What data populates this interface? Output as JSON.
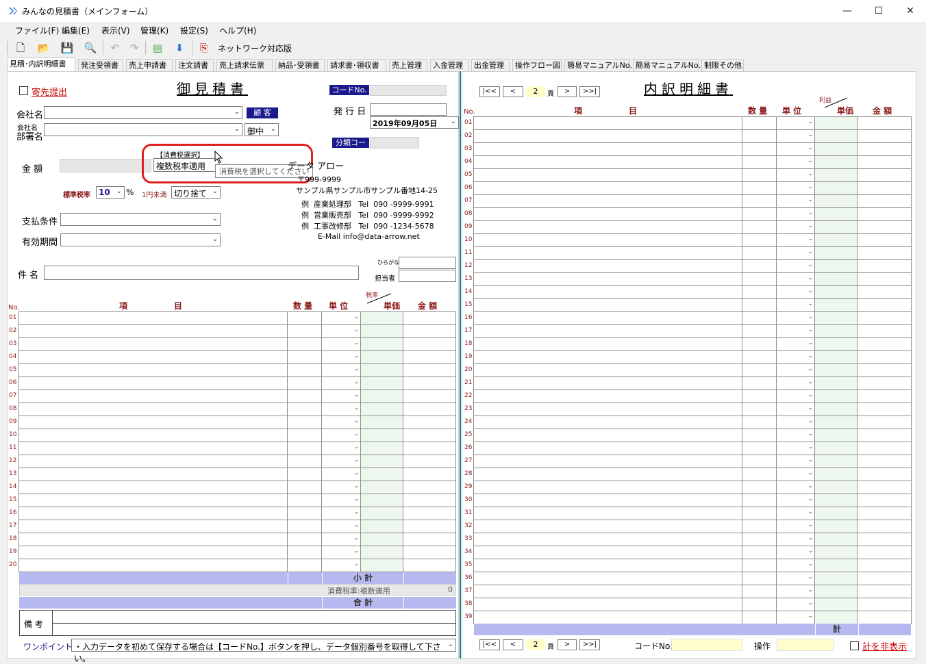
{
  "window": {
    "title": "みんなの見積書（メインフォーム）",
    "minimize": "—",
    "maximize": "☐",
    "close": "✕"
  },
  "menu": [
    "ファイル(F)",
    "編集(E)",
    "表示(V)",
    "管理(K)",
    "設定(S)",
    "ヘルプ(H)"
  ],
  "toolbar": {
    "network_label": "ネットワーク対応版"
  },
  "tabs": [
    "見積･内訳明細書",
    "発注受領書",
    "売上申請書",
    "注文請書",
    "売上請求伝票",
    "納品･受領書",
    "請求書･領収書",
    "売上管理",
    "入金管理",
    "出金管理",
    "操作フロー図",
    "簡易マニュアルNo.1",
    "簡易マニュアルNo.2",
    "制限その他"
  ],
  "estimate": {
    "title": "御見積書",
    "send_check": "寄先提出",
    "code_btn": "コードNo.",
    "issue_date_label": "発 行 日",
    "issue_date": "2019年09月05日",
    "class_code_btn": "分類コード",
    "company_label": "会社名",
    "customer_btn": "顧 客",
    "dept_label1": "会社名",
    "dept_label2": "部署名",
    "honorific": "御中",
    "tax_select_label": "【消費税選択】",
    "tax_select_value": "複数税率適用",
    "tooltip": "消費税を選択してください",
    "amount_label": "金 額",
    "rate_label": "標準税率",
    "rate_value": "10",
    "percent": "%",
    "rounding_label": "1円未満",
    "rounding_value": "切り捨て",
    "payment_label": "支払条件",
    "validity_label": "有効期間",
    "subject_label": "件 名",
    "furigana_label": "ひらがな",
    "staff_label": "担当者",
    "company_name": "データ アロー",
    "postal": "〒999-9999",
    "address": "サンプル県サンプル市サンプル番地14-25",
    "depts": [
      {
        "p": "例",
        "n": "産業処理部",
        "t": "Tel",
        "v": "090 -9999-9991"
      },
      {
        "p": "例",
        "n": "営業販売部",
        "t": "Tel",
        "v": "090 -9999-9992"
      },
      {
        "p": "例",
        "n": "工事改修部",
        "t": "Tel",
        "v": "090 -1234-5678"
      }
    ],
    "email": "E-Mail  info@data-arrow.net",
    "headers": {
      "no": "No.",
      "item1": "項",
      "item2": "目",
      "qty": "数 量",
      "unit": "単 位",
      "tax": "税率",
      "price": "単価",
      "amount": "金 額"
    },
    "rows": [
      "01",
      "02",
      "03",
      "04",
      "05",
      "06",
      "07",
      "08",
      "09",
      "10",
      "11",
      "12",
      "13",
      "14",
      "15",
      "16",
      "17",
      "18",
      "19",
      "20"
    ],
    "subtotal": "小 計",
    "tax_line": "消費税率:複数適用",
    "tax_amount": "0",
    "total": "合 計",
    "remarks": "備 考",
    "onepoint_label": "ワンポイント:",
    "onepoint_text": "・入力データを初めて保存する場合は【コードNo.】ボタンを押し、データ個別番号を取得して下さい。"
  },
  "detail": {
    "title": "内訳明細書",
    "nav": {
      "first": "|<<",
      "prev": "<",
      "page": "2",
      "page_unit": "頁",
      "next": ">",
      "last": ">>|"
    },
    "headers": {
      "no": "No.",
      "item1": "項",
      "item2": "目",
      "qty": "数 量",
      "unit": "単 位",
      "profit": "利益",
      "price": "単価",
      "amount": "金 額"
    },
    "rows": [
      "01",
      "02",
      "03",
      "04",
      "05",
      "06",
      "07",
      "08",
      "09",
      "10",
      "11",
      "12",
      "13",
      "14",
      "15",
      "16",
      "17",
      "18",
      "19",
      "20",
      "21",
      "22",
      "23",
      "24",
      "25",
      "26",
      "27",
      "28",
      "29",
      "30",
      "31",
      "32",
      "33",
      "34",
      "35",
      "36",
      "37",
      "38",
      "39"
    ],
    "total": "計",
    "code_label": "コードNo.",
    "op_label": "操作",
    "hide_total": "計を非表示"
  }
}
